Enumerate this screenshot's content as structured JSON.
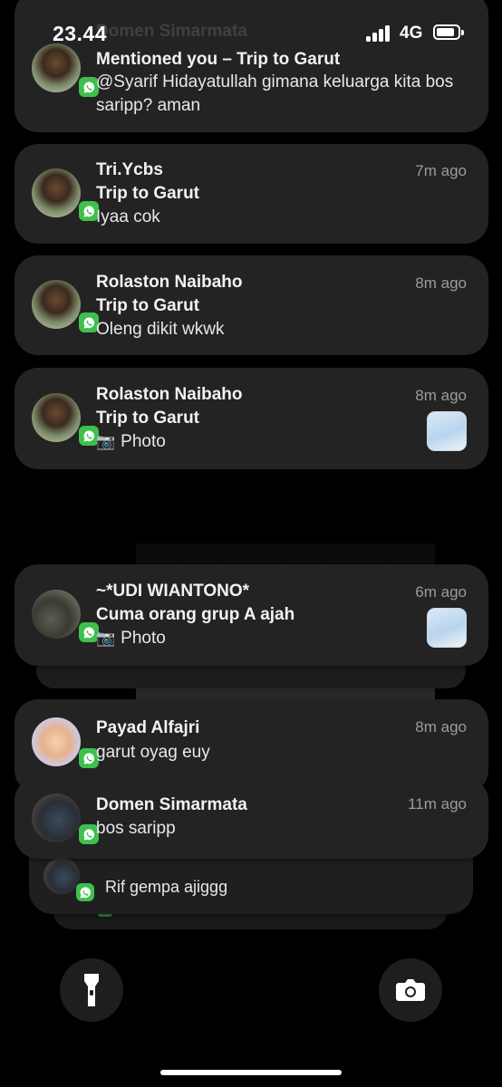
{
  "status_bar": {
    "time": "23.44",
    "network": "4G"
  },
  "notifications": [
    {
      "ghost_sender": "Domen Simarmata",
      "title": "Mentioned you – Trip to Garut",
      "body": "@Syarif Hidayatullah gimana keluarga kita bos saripp? aman",
      "time": ""
    },
    {
      "sender": "Tri.Ycbs",
      "title": "Trip to Garut",
      "body": "Iyaa cok",
      "time": "7m ago"
    },
    {
      "sender": "Rolaston Naibaho",
      "title": "Trip to Garut",
      "body": "Oleng dikit wkwk",
      "time": "8m ago"
    },
    {
      "sender": "Rolaston Naibaho",
      "title": "Trip to Garut",
      "body": "Photo",
      "time": "8m ago"
    },
    {
      "sender": "~*UDI WIANTONO*",
      "title": "Cuma orang grup A ajah",
      "body": "Photo",
      "time": "6m ago"
    },
    {
      "sender": "Payad Alfajri",
      "body": "garut oyag euy",
      "time": "8m ago"
    },
    {
      "sender": "Domen Simarmata",
      "body": "bos saripp",
      "time": "11m ago"
    },
    {
      "body": "Rif gempa ajiggg"
    }
  ],
  "icons": {
    "app_badge": "whatsapp-icon",
    "photo": "camera-icon",
    "flashlight": "flashlight-icon",
    "camera_button": "camera-icon"
  },
  "colors": {
    "background": "#000000",
    "card": "#232323",
    "whatsapp": "#3ec04c",
    "timestamp": "#9c9c9c"
  }
}
